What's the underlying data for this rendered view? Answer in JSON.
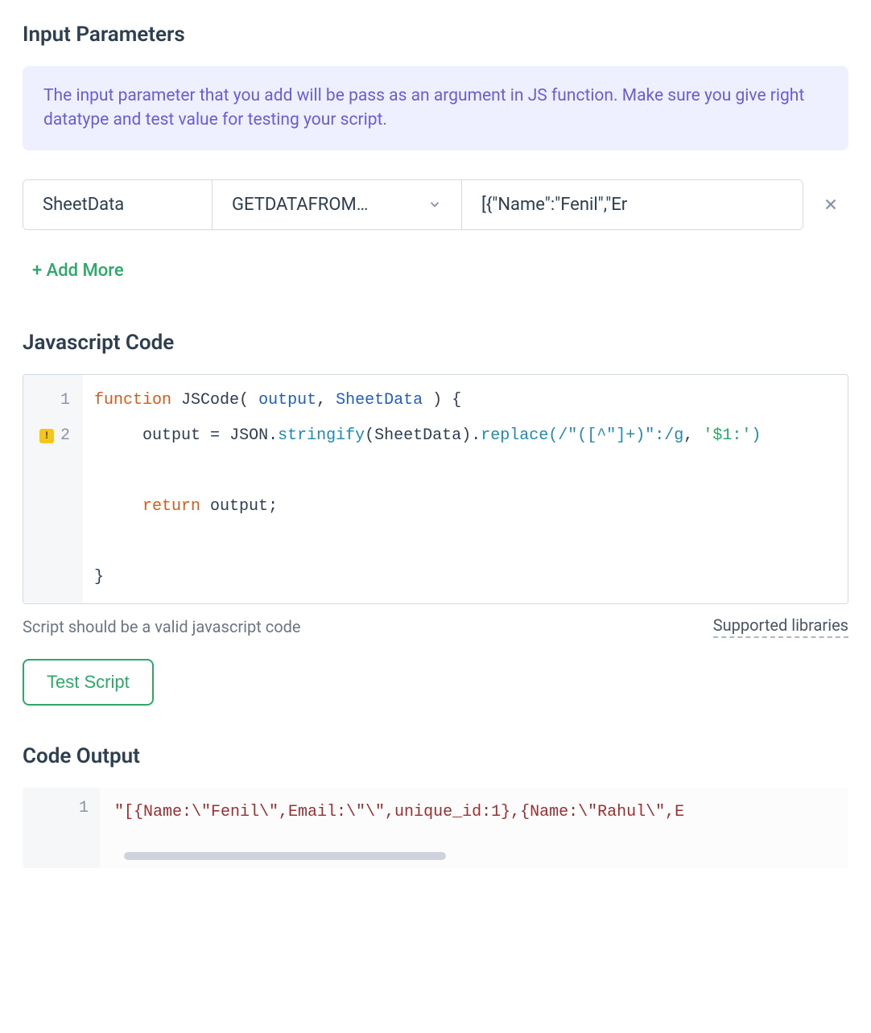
{
  "input_params": {
    "title": "Input Parameters",
    "info": "The input parameter that you add will be pass as an argument in JS function. Make sure you give right datatype and test value for testing your script.",
    "rows": [
      {
        "name": "SheetData",
        "type": "GETDATAFROM…",
        "value": "[{\"Name\":\"Fenil\",\"Er"
      }
    ],
    "add_more": "+ Add More"
  },
  "js_code": {
    "title": "Javascript Code",
    "gutter": {
      "line1": "1",
      "line2": "2"
    },
    "tokens": {
      "kw_function": "function",
      "fn_name": "JSCode",
      "paren_open": "(",
      "param_output": "output",
      "comma": ",",
      "param_sheet": "SheetData",
      "paren_close": ")",
      "brace_open": "{",
      "assign_lhs": "output",
      "eq": "=",
      "json_obj": "JSON",
      "dot1": ".",
      "stringify": "stringify",
      "call_open": "(",
      "arg_sheet": "SheetData",
      "call_close": ")",
      "dot2": ".",
      "replace": "replace",
      "rep_open": "(",
      "regex": "/\"([^\"]+)\":/g",
      "rep_comma": ",",
      "str": "'$1:'",
      "rep_close": ")",
      "kw_return": "return",
      "ret_id": "output",
      "semicolon": ";",
      "brace_close": "}"
    },
    "hint": "Script should be a valid javascript code",
    "supported": "Supported libraries",
    "test_btn": "Test Script"
  },
  "code_output": {
    "title": "Code Output",
    "gutter": "1",
    "text": "\"[{Name:\\\"Fenil\\\",Email:\\\"\\\",unique_id:1},{Name:\\\"Rahul\\\",E"
  }
}
